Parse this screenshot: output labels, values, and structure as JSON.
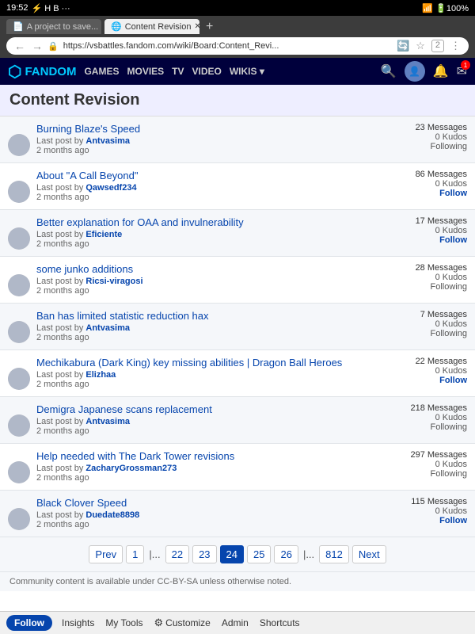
{
  "statusBar": {
    "time": "19:52",
    "icons": "🔋100%"
  },
  "tabs": [
    {
      "label": "A project to save...",
      "active": false,
      "favicon": "📄"
    },
    {
      "label": "Content Revision",
      "active": true,
      "favicon": "🌐"
    }
  ],
  "addressBar": {
    "url": "https://vsbattles.fandom.com/wiki/Board:Content_Revi..."
  },
  "fandamNav": {
    "logo": "FANDOM",
    "links": [
      "GAMES",
      "MOVIES",
      "TV",
      "VIDEO",
      "WIKIS"
    ],
    "wikisHasArrow": true
  },
  "pageTitle": "Content Revision",
  "threads": [
    {
      "title": "Burning Blaze's Speed",
      "lastPostBy": "Antvasima",
      "timeAgo": "2 months ago",
      "messages": "23 Messages",
      "kudos": "0 Kudos",
      "status": "Following",
      "isFollowing": true
    },
    {
      "title": "About \"A Call Beyond\"",
      "lastPostBy": "Qawsedf234",
      "timeAgo": "2 months ago",
      "messages": "86 Messages",
      "kudos": "0 Kudos",
      "status": "Follow",
      "isFollowing": false
    },
    {
      "title": "Better explanation for OAA and invulnerability",
      "lastPostBy": "Eficiente",
      "timeAgo": "2 months ago",
      "messages": "17 Messages",
      "kudos": "0 Kudos",
      "status": "Follow",
      "isFollowing": false
    },
    {
      "title": "some junko additions",
      "lastPostBy": "Ricsi-viragosi",
      "timeAgo": "2 months ago",
      "messages": "28 Messages",
      "kudos": "0 Kudos",
      "status": "Following",
      "isFollowing": true
    },
    {
      "title": "Ban has limited statistic reduction hax",
      "lastPostBy": "Antvasima",
      "timeAgo": "2 months ago",
      "messages": "7 Messages",
      "kudos": "0 Kudos",
      "status": "Following",
      "isFollowing": true
    },
    {
      "title": "Mechikabura (Dark King) key missing abilities | Dragon Ball Heroes",
      "lastPostBy": "Elizhaa",
      "timeAgo": "2 months ago",
      "messages": "22 Messages",
      "kudos": "0 Kudos",
      "status": "Follow",
      "isFollowing": false
    },
    {
      "title": "Demigra Japanese scans replacement",
      "lastPostBy": "Antvasima",
      "timeAgo": "2 months ago",
      "messages": "218 Messages",
      "kudos": "0 Kudos",
      "status": "Following",
      "isFollowing": true
    },
    {
      "title": "Help needed with The Dark Tower revisions",
      "lastPostBy": "ZacharyGrossman273",
      "timeAgo": "2 months ago",
      "messages": "297 Messages",
      "kudos": "0 Kudos",
      "status": "Following",
      "isFollowing": true
    },
    {
      "title": "Black Clover Speed",
      "lastPostBy": "Duedate8898",
      "timeAgo": "2 months ago",
      "messages": "115 Messages",
      "kudos": "0 Kudos",
      "status": "Follow",
      "isFollowing": false
    }
  ],
  "pagination": {
    "prev": "Prev",
    "next": "Next",
    "pages": [
      "1",
      "...",
      "22",
      "23",
      "24",
      "25",
      "26",
      "...",
      "812"
    ],
    "active": "24"
  },
  "footerNotice": "Community content is available under CC-BY-SA unless otherwise noted.",
  "bottomBar": {
    "followLabel": "Follow",
    "items": [
      {
        "label": "Insights",
        "icon": ""
      },
      {
        "label": "My Tools",
        "icon": ""
      },
      {
        "label": "⚙ Customize",
        "icon": "⚙"
      },
      {
        "label": "Admin",
        "icon": ""
      },
      {
        "label": "Shortcuts",
        "icon": ""
      }
    ]
  }
}
